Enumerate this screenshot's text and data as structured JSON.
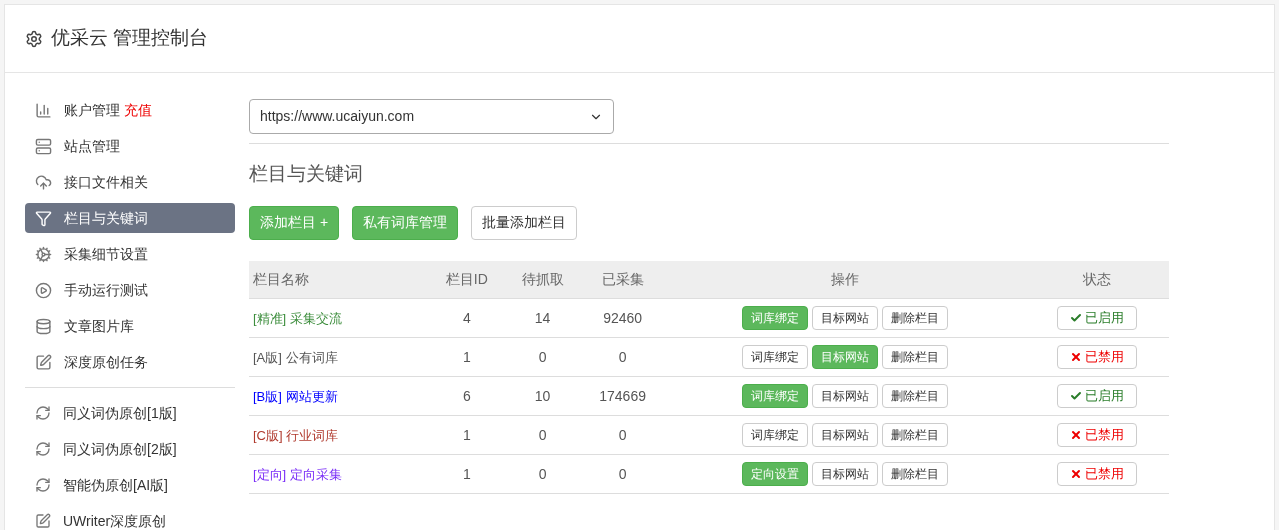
{
  "header": {
    "title": "优采云 管理控制台"
  },
  "sidebar": {
    "items": [
      {
        "label": "账户管理",
        "badge": "充值",
        "kind": "chart",
        "selected": false
      },
      {
        "label": "站点管理",
        "kind": "server",
        "selected": false
      },
      {
        "label": "接口文件相关",
        "kind": "cloud",
        "selected": false
      },
      {
        "label": "栏目与关键词",
        "kind": "filter",
        "selected": true
      },
      {
        "label": "采集细节设置",
        "kind": "gears",
        "selected": false
      },
      {
        "label": "手动运行测试",
        "kind": "play",
        "selected": false
      },
      {
        "label": "文章图片库",
        "kind": "database",
        "selected": false
      },
      {
        "label": "深度原创任务",
        "kind": "edit",
        "selected": false
      }
    ],
    "tools": [
      {
        "label": "同义词伪原创[1版]",
        "kind": "refresh"
      },
      {
        "label": "同义词伪原创[2版]",
        "kind": "refresh"
      },
      {
        "label": "智能伪原创[AI版]",
        "kind": "refresh"
      },
      {
        "label": "UWriter深度原创",
        "kind": "edit"
      }
    ]
  },
  "site_select": {
    "value": "https://www.ucaiyun.com"
  },
  "section_title": "栏目与关键词",
  "actions": [
    {
      "label": "添加栏目 +",
      "kind": "primary"
    },
    {
      "label": "私有词库管理",
      "kind": "primary"
    },
    {
      "label": "批量添加栏目",
      "kind": "default"
    }
  ],
  "table": {
    "columns": [
      "栏目名称",
      "栏目ID",
      "待抓取",
      "已采集",
      "操作",
      "状态"
    ],
    "rows": [
      {
        "tag": "[精准]",
        "name": "采集交流",
        "color": "#3c8d3c",
        "id": "4",
        "pending": "14",
        "collected": "92460",
        "ops": [
          {
            "label": "词库绑定",
            "kind": "primary"
          },
          {
            "label": "目标网站",
            "kind": "default"
          },
          {
            "label": "删除栏目",
            "kind": "default"
          }
        ],
        "status": "已启用",
        "enabled": true
      },
      {
        "tag": "[A版]",
        "name": "公有词库",
        "color": "#555555",
        "id": "1",
        "pending": "0",
        "collected": "0",
        "ops": [
          {
            "label": "词库绑定",
            "kind": "default"
          },
          {
            "label": "目标网站",
            "kind": "primary"
          },
          {
            "label": "删除栏目",
            "kind": "default"
          }
        ],
        "status": "已禁用",
        "enabled": false
      },
      {
        "tag": "[B版]",
        "name": "网站更新",
        "color": "#0000ff",
        "id": "6",
        "pending": "10",
        "collected": "174669",
        "ops": [
          {
            "label": "词库绑定",
            "kind": "primary"
          },
          {
            "label": "目标网站",
            "kind": "default"
          },
          {
            "label": "删除栏目",
            "kind": "default"
          }
        ],
        "status": "已启用",
        "enabled": true
      },
      {
        "tag": "[C版]",
        "name": "行业词库",
        "color": "#b03a2e",
        "id": "1",
        "pending": "0",
        "collected": "0",
        "ops": [
          {
            "label": "词库绑定",
            "kind": "default"
          },
          {
            "label": "目标网站",
            "kind": "default"
          },
          {
            "label": "删除栏目",
            "kind": "default"
          }
        ],
        "status": "已禁用",
        "enabled": false
      },
      {
        "tag": "[定向]",
        "name": "定向采集",
        "color": "#7b2ff7",
        "id": "1",
        "pending": "0",
        "collected": "0",
        "ops": [
          {
            "label": "定向设置",
            "kind": "primary"
          },
          {
            "label": "目标网站",
            "kind": "default"
          },
          {
            "label": "删除栏目",
            "kind": "default"
          }
        ],
        "status": "已禁用",
        "enabled": false
      }
    ]
  }
}
